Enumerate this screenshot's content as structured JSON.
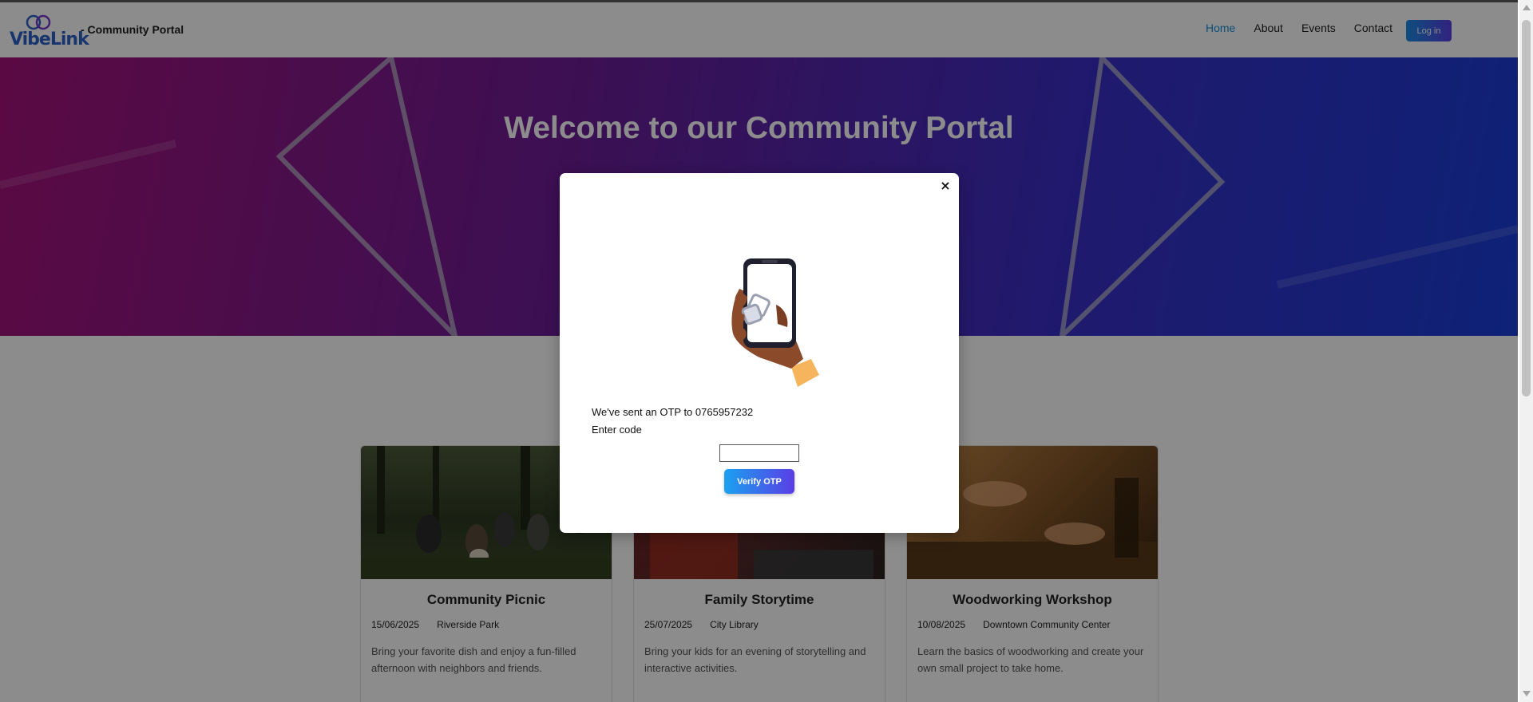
{
  "header": {
    "logo_text": "VibeLink",
    "site_title": "- Community Portal",
    "nav": [
      {
        "label": "Home",
        "active": true
      },
      {
        "label": "About",
        "active": false
      },
      {
        "label": "Events",
        "active": false
      },
      {
        "label": "Contact",
        "active": false
      }
    ],
    "login_label": "Log in"
  },
  "hero": {
    "title": "Welcome to our Community Portal",
    "subtitle": ""
  },
  "events": [
    {
      "title": "Community Picnic",
      "date": "15/06/2025",
      "location": "Riverside Park",
      "description": "Bring your favorite dish and enjoy a fun-filled afternoon with neighbors and friends."
    },
    {
      "title": "Family Storytime",
      "date": "25/07/2025",
      "location": "City Library",
      "description": "Bring your kids for an evening of storytelling and interactive activities."
    },
    {
      "title": "Woodworking Workshop",
      "date": "10/08/2025",
      "location": "Downtown Community Center",
      "description": "Learn the basics of woodworking and create your own small project to take home."
    }
  ],
  "modal": {
    "close_label": "×",
    "otp_message": "We've sent an OTP to 0765957232",
    "code_label": "Enter code",
    "code_value": "",
    "verify_label": "Verify OTP"
  },
  "colors": {
    "accent_start": "#1aa1f0",
    "accent_end": "#5a3ee6",
    "hero_start": "#a5127a",
    "hero_end": "#1a3ed8",
    "nav_active": "#1a8fd6"
  }
}
